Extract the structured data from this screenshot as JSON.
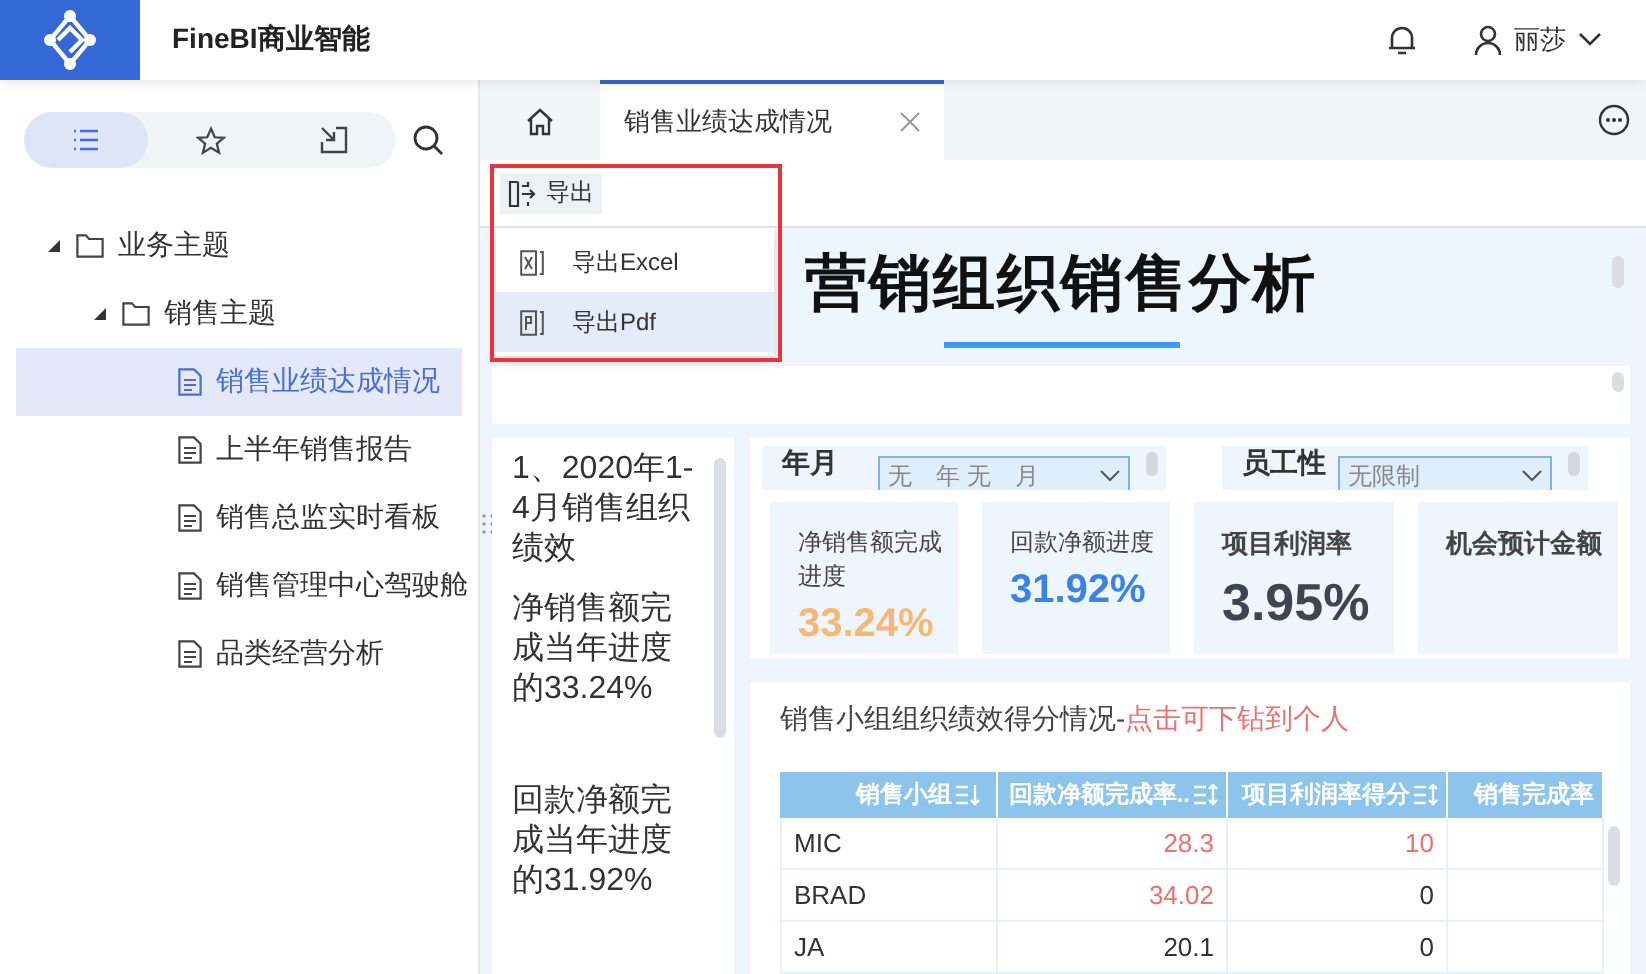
{
  "header": {
    "title": "FineBI商业智能",
    "user": "丽莎"
  },
  "sidebar": {
    "tabs": [
      {
        "kind": "list",
        "selected": true
      },
      {
        "kind": "star",
        "selected": false
      },
      {
        "kind": "export",
        "selected": false
      }
    ],
    "tree": [
      {
        "label": "业务主题",
        "kind": "folder",
        "expanded": true,
        "children": [
          {
            "label": "销售主题",
            "kind": "folder",
            "expanded": true,
            "children": [
              {
                "label": "销售业绩达成情况",
                "kind": "report",
                "selected": true
              },
              {
                "label": "上半年销售报告",
                "kind": "report",
                "selected": false
              },
              {
                "label": "销售总监实时看板",
                "kind": "report",
                "selected": false
              },
              {
                "label": "销售管理中心驾驶舱",
                "kind": "report",
                "selected": false
              },
              {
                "label": "品类经营分析",
                "kind": "report",
                "selected": false
              }
            ]
          }
        ]
      }
    ]
  },
  "tabs": [
    {
      "kind": "home",
      "selected": false
    },
    {
      "kind": "report",
      "label": "销售业绩达成情况",
      "selected": true
    }
  ],
  "export": {
    "label": "导出",
    "menu": [
      {
        "label": "导出Excel",
        "kind": "excel",
        "selected": false
      },
      {
        "label": "导出Pdf",
        "kind": "pdf",
        "selected": true
      }
    ]
  },
  "dashboard": {
    "title": "营销组织销售分析",
    "text_widget": [
      "1、2020年1-4月销售组织绩效",
      "净销售额完成当年进度的33.24%",
      "回款净额完成当年进度的31.92%"
    ],
    "filters": [
      {
        "label": "年月",
        "value": "无　年 无　月"
      },
      {
        "label": "员工性",
        "value": "无限制"
      }
    ],
    "kpis": [
      {
        "label": "净销售额完成进度",
        "value": "33.24%",
        "color": "#f7b874"
      },
      {
        "label": "回款净额进度",
        "value": "31.92%",
        "color": "#3b82e8"
      },
      {
        "label": "项目利润率",
        "value": "3.95%",
        "color": "#3d4554"
      },
      {
        "label": "机会预计金额"
      }
    ],
    "table": {
      "title": "销售小组组织绩效得分情况-",
      "title_link": "点击可下钻到个人",
      "columns": [
        {
          "label": "销售小组",
          "sortable": true,
          "sorted": true
        },
        {
          "label": "回款净额完成率..",
          "sortable": true,
          "sorted": false
        },
        {
          "label": "项目利润率得分",
          "sortable": true,
          "sorted": false
        },
        {
          "label": "销售完成率"
        }
      ],
      "rows": [
        [
          {
            "text": "MIC"
          },
          {
            "text": "28.3",
            "color": "#ef6f6f"
          },
          {
            "text": "10",
            "color": "#ef6f6f"
          }
        ],
        [
          {
            "text": "BRAD"
          },
          {
            "text": "34.02",
            "color": "#ef6f6f"
          },
          {
            "text": "0",
            "color": "#333333"
          }
        ],
        [
          {
            "text": "JA"
          },
          {
            "text": "20.1",
            "color": "#333333"
          },
          {
            "text": "0",
            "color": "#333333"
          }
        ]
      ]
    }
  }
}
